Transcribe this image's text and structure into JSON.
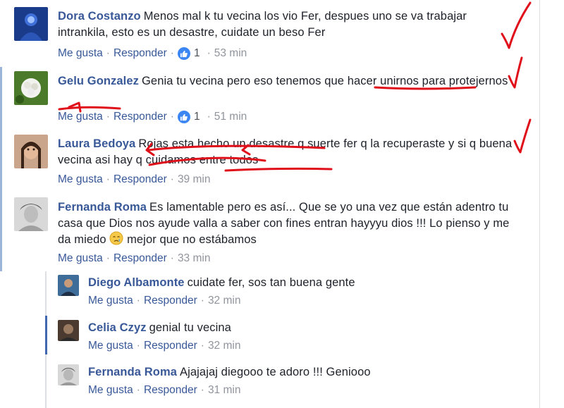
{
  "actions": {
    "like": "Me gusta",
    "reply": "Responder",
    "sep": "·"
  },
  "comments": [
    {
      "author": "Dora Costanzo",
      "text": "Menos mal k tu vecina los vio Fer, despues uno se va trabajar intrankila, esto es un desastre, cuidate un beso Fer",
      "likes": "1",
      "time": "53 min"
    },
    {
      "author": "Gelu Gonzalez",
      "text": "Genia tu vecina pero eso tenemos que hacer unirnos para protejernos",
      "likes": "1",
      "time": "51 min"
    },
    {
      "author": "Laura Bedoya",
      "text": "Rojas esta hecho un desastre q suerte fer q la recuperaste y si q buena vecina asi hay q cuidamos entre todos",
      "time": "39 min"
    },
    {
      "author": "Fernanda Roma",
      "text_a": "Es lamentable pero es así... Que se yo una vez que están adentro tu casa que Dios nos ayude valla a saber con fines entran hayyyu dios !!! Lo pienso y me da miedo",
      "emoji": "crying-face",
      "text_b": "mejor que no estábamos",
      "time": "33 min"
    }
  ],
  "replies": [
    {
      "author": "Diego Albamonte",
      "text": "cuidate fer, sos tan buena gente",
      "time": "32 min"
    },
    {
      "author": "Celia Czyz",
      "text": "genial tu vecina",
      "time": "32 min"
    },
    {
      "author": "Fernanda Roma",
      "text": "Ajajajaj diegooo te adoro !!! Geniooo",
      "time": "31 min"
    }
  ],
  "colors": {
    "author": "#385898",
    "annotation": "#e0101a",
    "like_badge": "#3b86f3",
    "thread_line": "#4267b2"
  }
}
